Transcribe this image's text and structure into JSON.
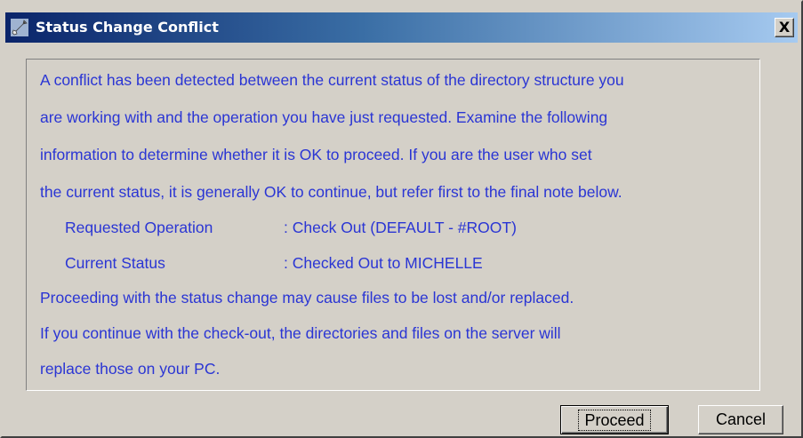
{
  "window": {
    "title": "Status Change Conflict",
    "close_label": "X",
    "title_icon": "wrench-icon"
  },
  "message": {
    "paragraph_lines": [
      "A conflict has been detected between the current status of the directory structure you",
      "are working with and the operation you have just requested.  Examine the following",
      "information to determine whether it is OK to proceed.  If you are the user who set",
      "the current status, it is generally OK to continue, but refer first to the final note below."
    ],
    "details": [
      {
        "label": "Requested Operation",
        "value": ": Check Out (DEFAULT - #ROOT)"
      },
      {
        "label": "Current Status",
        "value": ": Checked Out to MICHELLE"
      }
    ],
    "note_lines": [
      "Proceeding with the status change may cause files to be lost and/or replaced.",
      "If you continue with the check-out, the directories and files on the server will",
      "replace those on your PC."
    ]
  },
  "buttons": {
    "proceed_label": "Proceed",
    "cancel_label": "Cancel"
  },
  "colors": {
    "message_text": "#2a35d4",
    "titlebar_start": "#0a246a",
    "titlebar_end": "#a6caf0",
    "dialog_background": "#d4d0c8"
  }
}
